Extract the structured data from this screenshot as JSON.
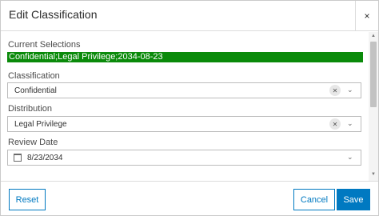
{
  "dialog": {
    "title": "Edit Classification",
    "close_glyph": "×"
  },
  "current_selections": {
    "label": "Current Selections",
    "value": "Confidential;Legal Privilege;2034-08-23",
    "highlight_color": "#0a8a0a"
  },
  "classification": {
    "label": "Classification",
    "value": "Confidential",
    "clear_glyph": "✕",
    "chevron_glyph": "⌄"
  },
  "distribution": {
    "label": "Distribution",
    "value": "Legal Privilege",
    "clear_glyph": "✕",
    "chevron_glyph": "⌄"
  },
  "review_date": {
    "label": "Review Date",
    "value": "8/23/2034",
    "icon": "calendar-icon",
    "chevron_glyph": "⌄"
  },
  "scrollbar": {
    "up_glyph": "▲",
    "down_glyph": "▼"
  },
  "footer": {
    "reset_label": "Reset",
    "cancel_label": "Cancel",
    "save_label": "Save",
    "accent_color": "#0079c1"
  }
}
